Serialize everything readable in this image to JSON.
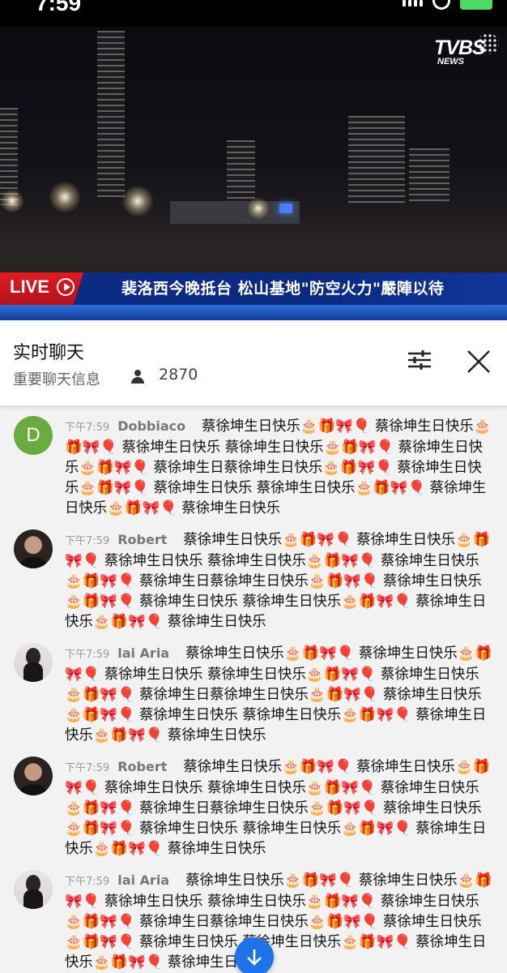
{
  "status_bar": {
    "time": "7:59"
  },
  "video": {
    "logo_main": "TVBS",
    "logo_sub": "NEWS",
    "live_label": "LIVE",
    "headline": "裴洛西今晚抵台 松山基地\"防空火力\"嚴陣以待"
  },
  "chat": {
    "title": "实时聊天",
    "subtitle": "重要聊天信息",
    "viewer_count": "2870",
    "messages": [
      {
        "time": "下午7:59",
        "author": "Dobbiaco",
        "avatar_letter": "D",
        "text": "蔡徐坤生日快乐🎂🎁🎀🎈 蔡徐坤生日快乐🎂🎁🎀🎈 蔡徐坤生日快乐 蔡徐坤生日快乐🎂🎁🎀🎈 蔡徐坤生日快乐🎂🎁🎀🎈 蔡徐坤生日蔡徐坤生日快乐🎂🎁🎀🎈 蔡徐坤生日快乐🎂🎁🎀🎈 蔡徐坤生日快乐 蔡徐坤生日快乐🎂🎁🎀🎈 蔡徐坤生日快乐🎂🎁🎀🎈 蔡徐坤生日快乐"
      },
      {
        "time": "下午7:59",
        "author": "Robert",
        "text": "蔡徐坤生日快乐🎂🎁🎀🎈 蔡徐坤生日快乐🎂🎁🎀🎈 蔡徐坤生日快乐 蔡徐坤生日快乐🎂🎁🎀🎈 蔡徐坤生日快乐🎂🎁🎀🎈 蔡徐坤生日蔡徐坤生日快乐🎂🎁🎀🎈 蔡徐坤生日快乐🎂🎁🎀🎈 蔡徐坤生日快乐 蔡徐坤生日快乐🎂🎁🎀🎈 蔡徐坤生日快乐🎂🎁🎀🎈 蔡徐坤生日快乐"
      },
      {
        "time": "下午7:59",
        "author": "lai Aria",
        "text": "蔡徐坤生日快乐🎂🎁🎀🎈 蔡徐坤生日快乐🎂🎁🎀🎈 蔡徐坤生日快乐 蔡徐坤生日快乐🎂🎁🎀🎈 蔡徐坤生日快乐🎂🎁🎀🎈 蔡徐坤生日蔡徐坤生日快乐🎂🎁🎀🎈 蔡徐坤生日快乐🎂🎁🎀🎈 蔡徐坤生日快乐 蔡徐坤生日快乐🎂🎁🎀🎈 蔡徐坤生日快乐🎂🎁🎀🎈 蔡徐坤生日快乐"
      },
      {
        "time": "下午7:59",
        "author": "Robert",
        "text": "蔡徐坤生日快乐🎂🎁🎀🎈 蔡徐坤生日快乐🎂🎁🎀🎈 蔡徐坤生日快乐 蔡徐坤生日快乐🎂🎁🎀🎈 蔡徐坤生日快乐🎂🎁🎀🎈 蔡徐坤生日蔡徐坤生日快乐🎂🎁🎀🎈 蔡徐坤生日快乐🎂🎁🎀🎈 蔡徐坤生日快乐 蔡徐坤生日快乐🎂🎁🎀🎈 蔡徐坤生日快乐🎂🎁🎀🎈 蔡徐坤生日快乐"
      },
      {
        "time": "下午7:59",
        "author": "lai Aria",
        "text": "蔡徐坤生日快乐🎂🎁🎀🎈 蔡徐坤生日快乐🎂🎁🎀🎈 蔡徐坤生日快乐 蔡徐坤生日快乐🎂🎁🎀🎈 蔡徐坤生日快乐🎂🎁🎀🎈 蔡徐坤生日蔡徐坤生日快乐🎂🎁🎀🎈 蔡徐坤生日快乐🎂🎁🎀🎈 蔡徐坤生日快乐 蔡徐坤生日快乐🎂🎁🎀🎈 蔡徐坤生日快乐🎂🎁🎀🎈 蔡徐坤生日快乐"
      }
    ]
  }
}
